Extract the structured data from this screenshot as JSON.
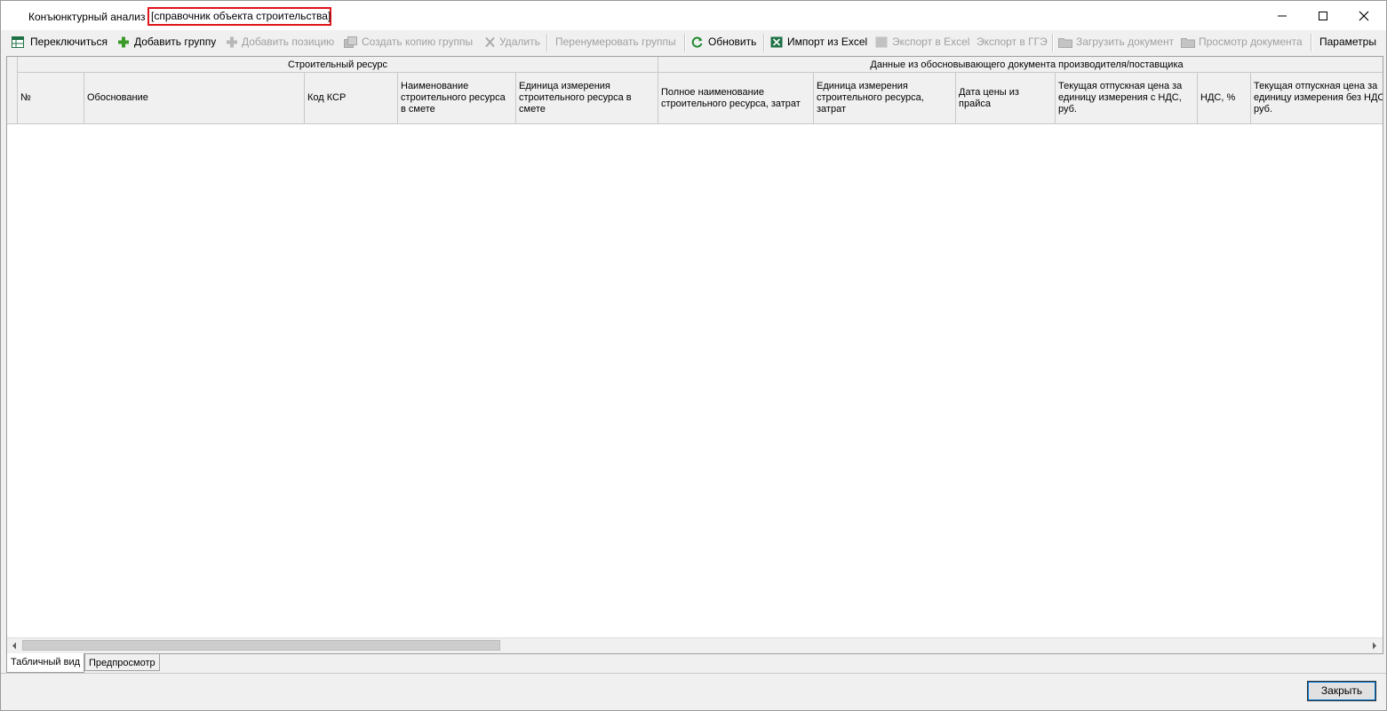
{
  "window": {
    "title": "Конъюнктурный анализ",
    "title_highlight": "[справочник объекта строительства]"
  },
  "toolbar": {
    "switch": "Переключиться",
    "add_group": "Добавить группу",
    "add_position": "Добавить позицию",
    "copy_group": "Создать копию группы",
    "delete": "Удалить",
    "renumber_groups": "Перенумеровать группы",
    "refresh": "Обновить",
    "import_excel": "Импорт из Excel",
    "export_excel": "Экспорт в Excel",
    "export_gge": "Экспорт в ГГЭ",
    "upload_document": "Загрузить документ",
    "view_document": "Просмотр документа",
    "parameters": "Параметры"
  },
  "grid": {
    "group_resource": "Строительный ресурс",
    "group_supplier": "Данные из обосновывающего документа производителя/поставщика",
    "columns": [
      "№",
      "Обоснование",
      "Код КСР",
      "Наименование строительного ресурса в смете",
      "Единица измерения строительного ресурса в смете",
      "Полное наименование строительного ресурса, затрат",
      "Единица измерения строительного ресурса, затрат",
      "Дата цены из прайса",
      "Текущая отпускная цена за единицу измерения с НДС, руб.",
      "НДС, %",
      "Текущая отпускная цена за единицу измерения без НДС, руб."
    ]
  },
  "tabs": {
    "table_view": "Табличный вид",
    "preview": "Предпросмотр"
  },
  "footer": {
    "close_button": "Закрыть"
  },
  "colors": {
    "highlight_border": "#e0151a",
    "excel_green": "#1e7145",
    "add_green": "#3a9a2a"
  }
}
